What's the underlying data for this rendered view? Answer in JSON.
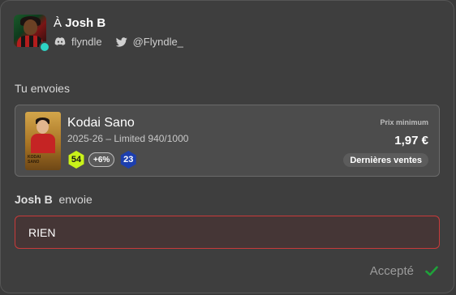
{
  "recipient": {
    "prefix": "À",
    "name": "Josh B",
    "discord": "flyndle",
    "twitter": "@Flyndle_",
    "status_color": "#2ed3c4"
  },
  "you_send": {
    "label": "Tu envoies",
    "card": {
      "player_name": "Kodai Sano",
      "subtitle": "2025-26 – Limited 940/1000",
      "card_text": "KODAI\nSANO",
      "score": "54",
      "bonus": "+6%",
      "level": "23",
      "price_label": "Prix minimum",
      "price_value": "1,97 €",
      "recent_sales_label": "Dernières ventes"
    }
  },
  "sender": {
    "name": "Josh B",
    "verb": "envoie",
    "offer_value": "RIEN"
  },
  "status": {
    "label": "Accepté",
    "icon": "check-icon",
    "color": "#1fa23a"
  },
  "colors": {
    "accent_border": "#c83a3a",
    "score_badge": "#c9f21a",
    "level_badge": "#1d3fae"
  }
}
